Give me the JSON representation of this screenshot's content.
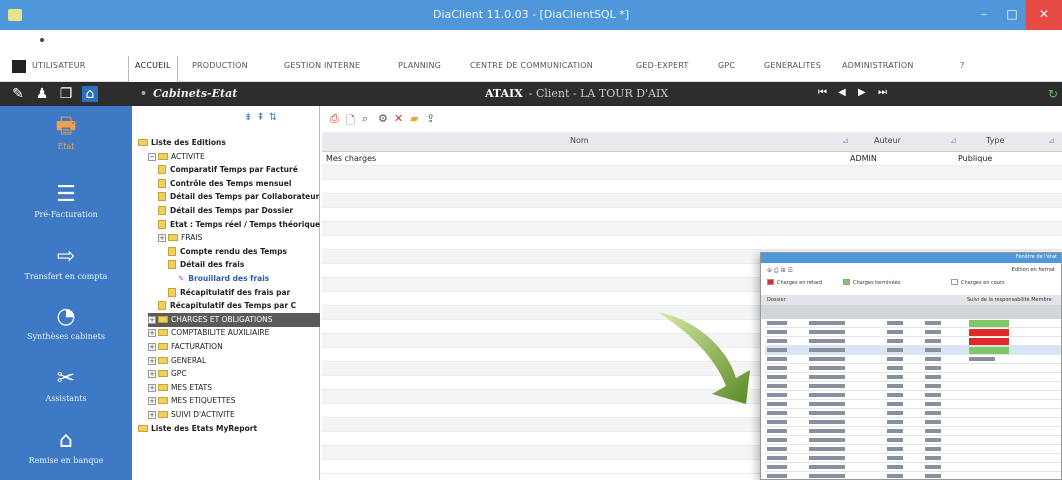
{
  "window": {
    "title": "DiaClient 11.0.03 - [DiaClientSQL *]",
    "minimize_glyph": "–",
    "maximize_glyph": "□",
    "close_glyph": "✕"
  },
  "menu": {
    "items": [
      "UTILISATEUR",
      "ACCUEIL",
      "PRODUCTION",
      "GESTION INTERNE",
      "PLANNING",
      "CENTRE DE COMMUNICATION",
      "GED-EXPERT",
      "GPC",
      "GENERALITES",
      "ADMINISTRATION",
      "?"
    ]
  },
  "header": {
    "section_title": "Cabinets-Etat",
    "client_code": "ATAIX",
    "client_name": "- Client - LA TOUR D'AIX",
    "nav": [
      "⏮",
      "◀",
      "▶",
      "⏭"
    ]
  },
  "sidebar": {
    "items": [
      {
        "label": "Etat",
        "icon": "printer-icon"
      },
      {
        "label": "Pré-Facturation",
        "icon": "invoice-icon"
      },
      {
        "label": "Transfert en compta",
        "icon": "transfer-icon"
      },
      {
        "label": "Synthèses cabinets",
        "icon": "pie-chart-icon"
      },
      {
        "label": "Assistants",
        "icon": "tools-icon"
      },
      {
        "label": "Remise en banque",
        "icon": "bank-icon"
      }
    ]
  },
  "tree": {
    "nodes": [
      {
        "label": "Liste des Editions",
        "level": 0,
        "kind": "root"
      },
      {
        "label": "ACTIVITE",
        "level": 1,
        "kind": "folder"
      },
      {
        "label": "Comparatif Temps par Facturé",
        "level": 2,
        "kind": "doc"
      },
      {
        "label": "Contrôle des Temps mensuel",
        "level": 2,
        "kind": "doc"
      },
      {
        "label": "Détail des Temps par Collaborateur",
        "level": 2,
        "kind": "doc"
      },
      {
        "label": "Détail des Temps par Dossier",
        "level": 2,
        "kind": "doc"
      },
      {
        "label": "Etat : Temps réel / Temps théorique",
        "level": 2,
        "kind": "doc"
      },
      {
        "label": "FRAIS",
        "level": 2,
        "kind": "folder"
      },
      {
        "label": "Compte rendu des Temps",
        "level": 3,
        "kind": "doc"
      },
      {
        "label": "Détail des frais",
        "level": 3,
        "kind": "doc"
      },
      {
        "label": "Brouillard des frais",
        "level": 4,
        "kind": "accent"
      },
      {
        "label": "Récapitulatif des frais par",
        "level": 3,
        "kind": "doc"
      },
      {
        "label": "Récapitulatif des Temps par C",
        "level": 2,
        "kind": "doc"
      },
      {
        "label": "CHARGES ET OBLIGATIONS",
        "level": 1,
        "kind": "selected"
      },
      {
        "label": "COMPTABILITE AUXILIAIRE",
        "level": 1,
        "kind": "folder"
      },
      {
        "label": "FACTURATION",
        "level": 1,
        "kind": "folder"
      },
      {
        "label": "GENERAL",
        "level": 1,
        "kind": "folder"
      },
      {
        "label": "GPC",
        "level": 1,
        "kind": "folder"
      },
      {
        "label": "MES ETATS",
        "level": 1,
        "kind": "folder"
      },
      {
        "label": "MES ETIQUETTES",
        "level": 1,
        "kind": "folder"
      },
      {
        "label": "SUIVI D'ACTIVITE",
        "level": 1,
        "kind": "folder"
      },
      {
        "label": "Liste des Etats MyReport",
        "level": 0,
        "kind": "root"
      }
    ]
  },
  "table": {
    "columns": [
      "Nom",
      "Auteur",
      "Type"
    ],
    "rows": [
      {
        "nom": "Mes charges",
        "auteur": "ADMIN",
        "type": "Publique"
      }
    ]
  },
  "preview": {
    "title": "Fenêtre de l'état",
    "right_label": "Edition en format",
    "legend": [
      "Charges en retard",
      "Charges terminées",
      "Charges en cours"
    ],
    "legend_colors": [
      "#e02a2a",
      "#7ec86a",
      "#ffffff"
    ],
    "subheader_left": "Dossier",
    "subheader_right": "Suivi de la responsabilité   Membre"
  },
  "colors": {
    "titlebar": "#4f97da",
    "sidebar": "#3d79c4",
    "header": "#2d2d2d",
    "close": "#e74a45"
  }
}
